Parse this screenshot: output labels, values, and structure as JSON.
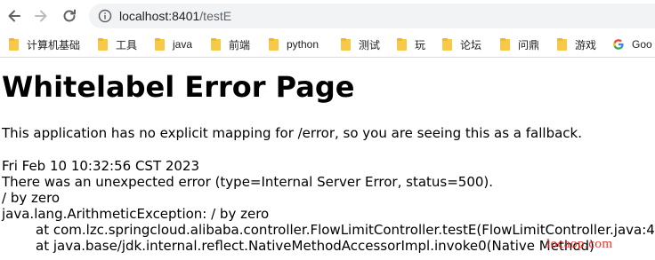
{
  "browser": {
    "url_host": "localhost:8401",
    "url_path": "/testE",
    "bookmarks": [
      {
        "label": "计算机基础",
        "icon": "folder-icon"
      },
      {
        "label": "工具",
        "icon": "folder-icon"
      },
      {
        "label": "java",
        "icon": "folder-icon"
      },
      {
        "label": "前端",
        "icon": "folder-icon"
      },
      {
        "label": "python",
        "icon": "folder-icon"
      },
      {
        "label": "测试",
        "icon": "folder-icon"
      },
      {
        "label": "玩",
        "icon": "folder-icon"
      },
      {
        "label": "论坛",
        "icon": "folder-icon"
      },
      {
        "label": "问鼎",
        "icon": "folder-icon"
      },
      {
        "label": "游戏",
        "icon": "folder-icon"
      },
      {
        "label": "Goo",
        "icon": "google-icon"
      }
    ]
  },
  "page": {
    "title": "Whitelabel Error Page",
    "lead": "This application has no explicit mapping for /error, so you are seeing this as a fallback.",
    "timestamp": "Fri Feb 10 10:32:56 CST 2023",
    "error_line": "There was an unexpected error (type=Internal Server Error, status=500).",
    "message": "/ by zero",
    "exception": "java.lang.ArithmeticException: / by zero",
    "stack": [
      "at com.lzc.springcloud.alibaba.controller.FlowLimitController.testE(FlowLimitController.java:4",
      "at java.base/jdk.internal.reflect.NativeMethodAccessorImpl.invoke0(Native Method)"
    ]
  },
  "watermark": "locaop.com",
  "colors": {
    "watermark": "#e8352e",
    "folder": "#f7c948"
  }
}
